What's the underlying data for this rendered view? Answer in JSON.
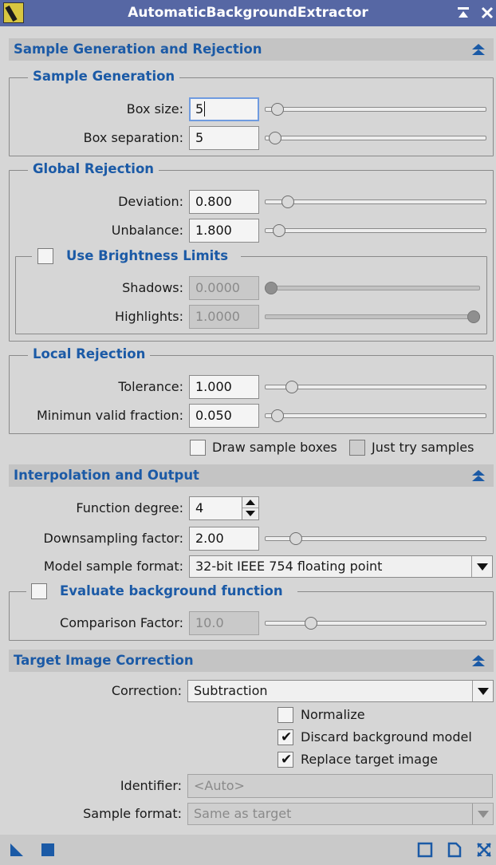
{
  "window": {
    "title": "AutomaticBackgroundExtractor"
  },
  "sections": {
    "sample_gen_rejection": "Sample Generation and Rejection",
    "interpolation_output": "Interpolation and Output",
    "target_image_correction": "Target Image Correction"
  },
  "sample_generation": {
    "title": "Sample Generation",
    "box_size_label": "Box size:",
    "box_size_value": "5",
    "box_size_slider": 0.03,
    "box_separation_label": "Box separation:",
    "box_separation_value": "5",
    "box_separation_slider": 0.02
  },
  "global_rejection": {
    "title": "Global Rejection",
    "deviation_label": "Deviation:",
    "deviation_value": "0.800",
    "deviation_slider": 0.08,
    "unbalance_label": "Unbalance:",
    "unbalance_value": "1.800",
    "unbalance_slider": 0.04,
    "brightness_limits": {
      "title": "Use Brightness Limits",
      "checked": false,
      "shadows_label": "Shadows:",
      "shadows_value": "0.0000",
      "shadows_slider": 0.0,
      "highlights_label": "Highlights:",
      "highlights_value": "1.0000",
      "highlights_slider": 1.0
    }
  },
  "local_rejection": {
    "title": "Local Rejection",
    "tolerance_label": "Tolerance:",
    "tolerance_value": "1.000",
    "tolerance_slider": 0.1,
    "min_valid_fraction_label": "Minimun valid fraction:",
    "min_valid_fraction_value": "0.050",
    "min_valid_fraction_slider": 0.03
  },
  "sample_options": {
    "draw_sample_boxes_label": "Draw sample boxes",
    "draw_sample_boxes_checked": false,
    "just_try_samples_label": "Just try samples",
    "just_try_samples_checked": false
  },
  "interpolation": {
    "function_degree_label": "Function degree:",
    "function_degree_value": "4",
    "downsampling_label": "Downsampling factor:",
    "downsampling_value": "2.00",
    "downsampling_slider": 0.12,
    "model_format_label": "Model sample format:",
    "model_format_value": "32-bit IEEE 754 floating point",
    "evaluate_bg": {
      "title": "Evaluate background function",
      "checked": false,
      "comparison_label": "Comparison Factor:",
      "comparison_value": "10.0",
      "comparison_slider": 0.19
    }
  },
  "target": {
    "correction_label": "Correction:",
    "correction_value": "Subtraction",
    "normalize_label": "Normalize",
    "normalize_checked": false,
    "discard_label": "Discard background model",
    "discard_checked": true,
    "replace_label": "Replace target image",
    "replace_checked": true,
    "identifier_label": "Identifier:",
    "identifier_placeholder": "<Auto>",
    "sample_format_label": "Sample format:",
    "sample_format_value": "Same as target"
  },
  "icons": {
    "app": "abe-app-icon",
    "pin": "pin-icon",
    "close": "close-icon",
    "collapse": "collapse-up-icon",
    "new_instance": "new-instance-triangle-icon",
    "apply_global": "apply-global-square-icon",
    "reset": "reset-icon",
    "preferences": "document-icon",
    "expand": "expand-arrows-icon"
  },
  "colors": {
    "titlebar": "#5667a4",
    "section_text": "#1b5aa6",
    "accent_icon": "#1b5aa6"
  }
}
